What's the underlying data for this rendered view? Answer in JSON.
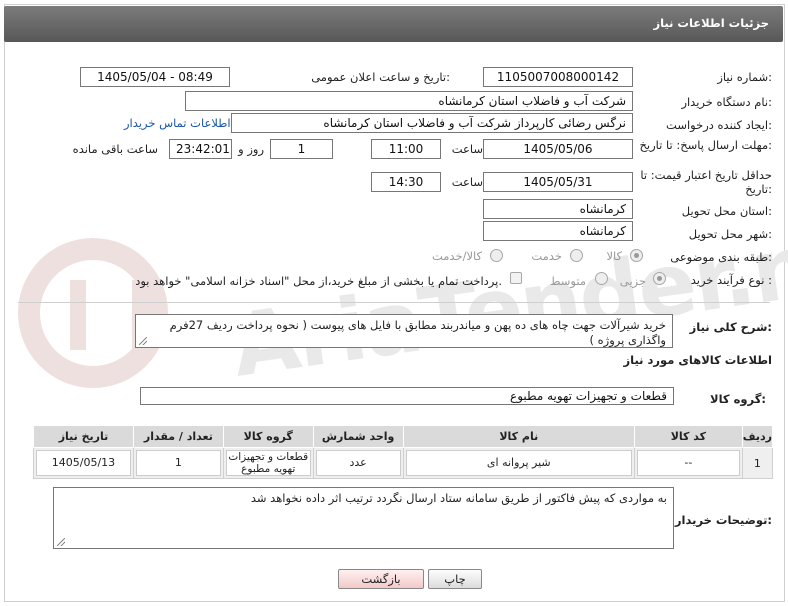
{
  "header": {
    "title": "جزئیات اطلاعات نیاز"
  },
  "watermark": {
    "text": "AriaTender.net"
  },
  "fields": {
    "need_number_label": "شماره نیاز:",
    "need_number": "1105007008000142",
    "announce_label": "تاریخ و ساعت اعلان عمومی:",
    "announce_value": "1405/05/04 - 08:49",
    "buyer_org_label": "نام دستگاه خریدار:",
    "buyer_org": "شرکت آب و فاضلاب استان کرمانشاه",
    "creator_label": "ایجاد کننده درخواست:",
    "creator": "نرگس رضائی کارپرداز شرکت آب و فاضلاب استان کرمانشاه",
    "buyer_contact_link": "اطلاعات تماس خریدار",
    "deadline_label": "مهلت ارسال پاسخ: تا تاریخ:",
    "deadline_date": "1405/05/06",
    "time_label": "ساعت",
    "deadline_time": "11:00",
    "days_value": "1",
    "days_label": "روز و",
    "remaining_time": "23:42:01",
    "remaining_label": "ساعت باقی مانده",
    "price_validity_label": "حداقل تاریخ اعتبار قیمت: تا تاریخ:",
    "price_date": "1405/05/31",
    "price_time_label": "ساعت",
    "price_time": "14:30",
    "province_label": "استان محل تحویل:",
    "province": "کرمانشاه",
    "city_label": "شهر محل تحویل:",
    "city": "کرمانشاه",
    "category_label": "طبقه بندی موضوعی:",
    "category_options": [
      "کالا",
      "خدمت",
      "کالا/خدمت"
    ],
    "process_label": "نوع فرآیند خرید :",
    "process_options": [
      "جزیی",
      "متوسط"
    ],
    "payment_note": "پرداخت تمام یا بخشی از مبلغ خرید،از محل \"اسناد خزانه اسلامی\" خواهد بود.",
    "description_label": "شرح کلی نیاز:",
    "description": "خرید شیرآلات  جهت چاه های ده پهن و میاندربند  مطابق با فایل های پیوست ( نحوه پرداخت ردیف 27فرم واگذاری پروژه )",
    "goods_info_title": "اطلاعات کالاهای مورد نیاز",
    "goods_group_label": "گروه کالا:",
    "goods_group": "قطعات و تجهیزات تهویه مطبوع",
    "buyer_notes_label": "توضیحات خریدار:",
    "buyer_notes": "به مواردی که پیش فاکتور از طریق سامانه ستاد ارسال نگردد ترتیب اثر داده نخواهد شد"
  },
  "table": {
    "headers": [
      "ردیف",
      "کد کالا",
      "نام کالا",
      "واحد شمارش",
      "گروه کالا",
      "تعداد / مقدار",
      "تاریخ نیاز"
    ],
    "rows": [
      [
        "1",
        "--",
        "شیر پروانه ای",
        "عدد",
        "قطعات و تجهیزات تهویه مطبوع",
        "1",
        "1405/05/13"
      ]
    ]
  },
  "buttons": {
    "print": "چاپ",
    "back": "بازگشت"
  },
  "colors": {
    "header_bg": "#666666",
    "link": "#1a56a8",
    "back_button": "#f3c9c9"
  }
}
